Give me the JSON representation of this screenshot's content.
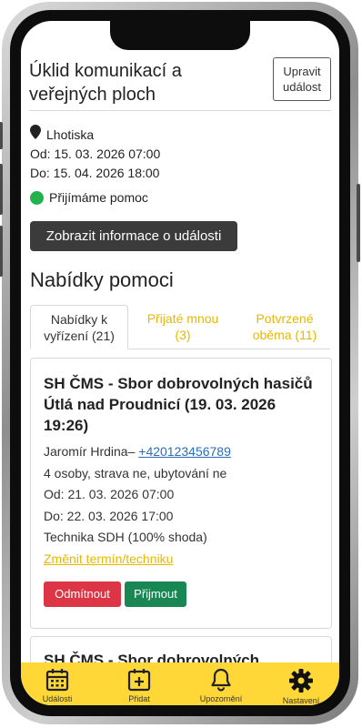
{
  "event": {
    "title": "Úklid komunikací a veřejných ploch",
    "edit_label": "Upravit událost",
    "location": "Lhotiska",
    "from": "Od: 15. 03. 2026 07:00",
    "to": "Do: 15. 04. 2026 18:00",
    "status": "Přijímáme pomoc",
    "status_color": "#22b14c",
    "info_button": "Zobrazit informace o události"
  },
  "offers": {
    "title": "Nabídky pomoci",
    "tabs": [
      {
        "label": "Nabídky k vyřízení (21)"
      },
      {
        "label": "Přijaté mnou (3)"
      },
      {
        "label": "Potvrzené oběma (11)"
      }
    ],
    "cards": [
      {
        "title": "SH ČMS - Sbor dobrovolných hasičů Útlá nad Proudnicí (19. 03. 2026 19:26)",
        "contact_name": "Jaromír Hrdina–",
        "phone": "+420123456789",
        "details": "4 osoby, strava ne, ubytování ne",
        "from": "Od: 21. 03. 2026 07:00",
        "to": "Do: 22. 03. 2026 17:00",
        "equipment": "Technika SDH (100% shoda)",
        "change_link": "Změnit termín/techniku",
        "reject_label": "Odmítnout",
        "accept_label": "Přijmout"
      },
      {
        "title": "SH ČMS - Sbor dobrovolných"
      }
    ]
  },
  "nav": {
    "items": [
      {
        "label": "Události",
        "icon": "calendar-icon"
      },
      {
        "label": "Přidat",
        "icon": "calendar-plus-icon"
      },
      {
        "label": "Upozornění",
        "icon": "bell-icon"
      },
      {
        "label": "Nastavení",
        "icon": "gear-icon"
      }
    ]
  },
  "colors": {
    "accent_yellow": "#ffd838",
    "link_yellow": "#e6b800",
    "reject_red": "#dc3545",
    "accept_green": "#198754"
  }
}
